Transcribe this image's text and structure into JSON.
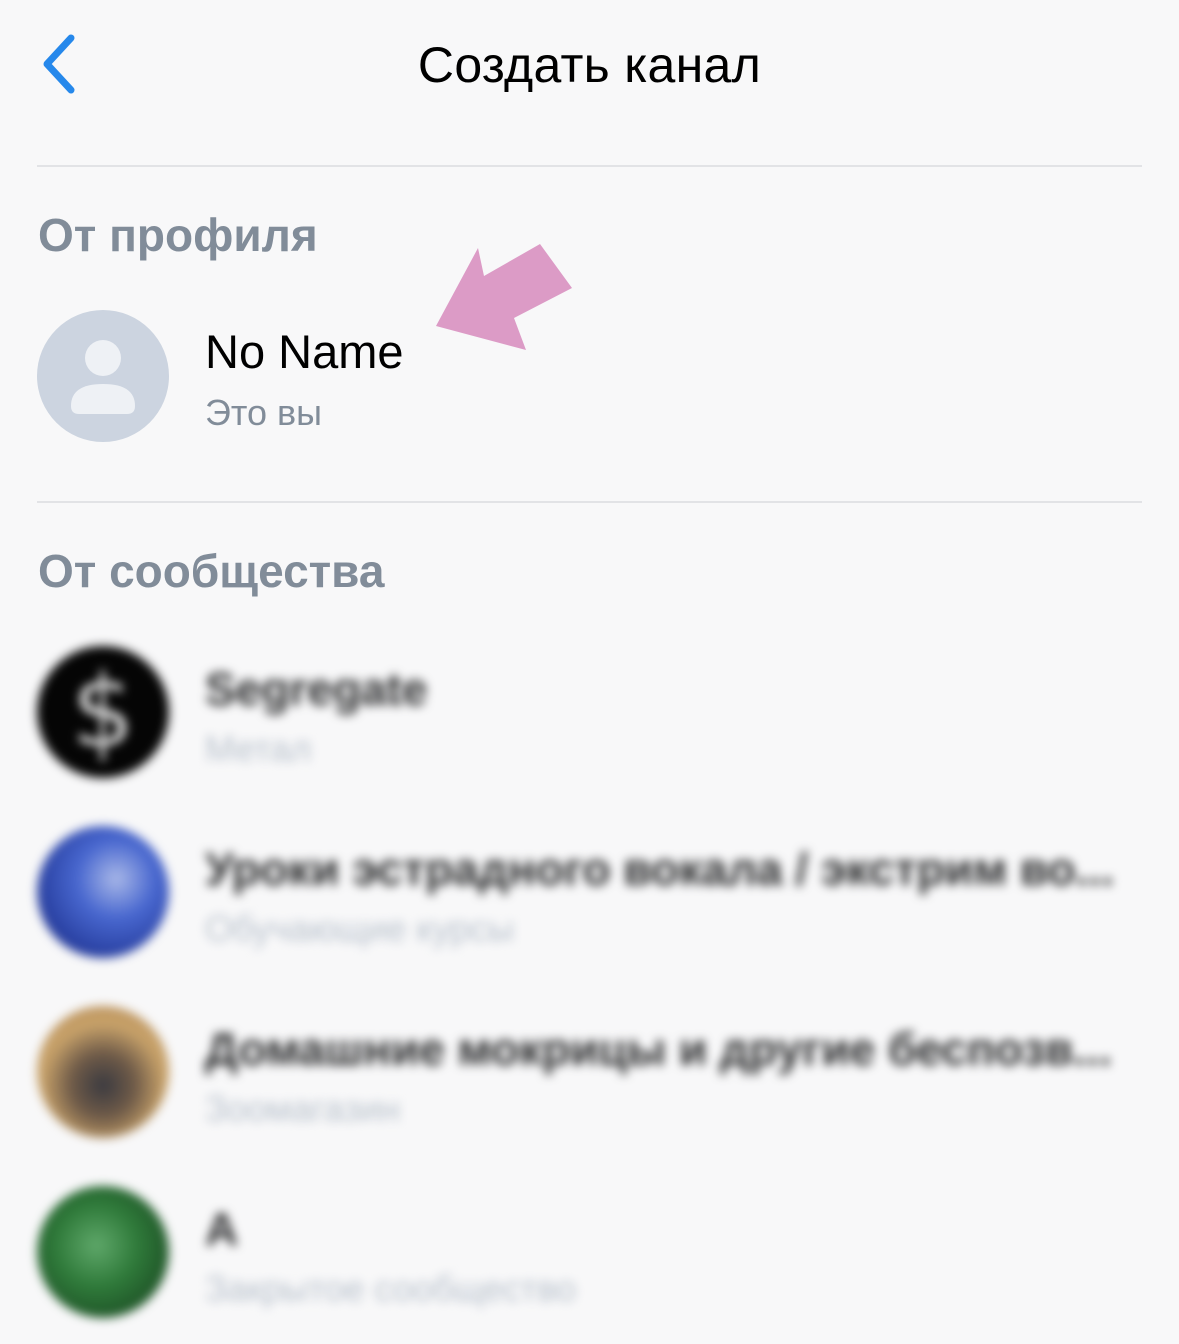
{
  "header": {
    "title": "Создать канал",
    "back_icon": "chevron-left-icon",
    "accent_color": "#2688eb"
  },
  "profile_section": {
    "title": "От профиля",
    "item": {
      "name": "No Name",
      "subtitle": "Это вы",
      "avatar_icon": "user-placeholder-icon"
    }
  },
  "community_section": {
    "title": "От сообщества",
    "items": [
      {
        "name": "Segregate",
        "subtitle": "Метал"
      },
      {
        "name": "Уроки эстрадного вокала / экстрим во...",
        "subtitle": "Обучающие курсы"
      },
      {
        "name": "Домашние мокрицы и другие беспозв...",
        "subtitle": "Зоомагазин"
      },
      {
        "name": "A",
        "subtitle": "Закрытое сообщество"
      }
    ]
  },
  "annotation": {
    "arrow_color": "#dc9bc6",
    "arrow_icon": "pointer-arrow-icon"
  }
}
